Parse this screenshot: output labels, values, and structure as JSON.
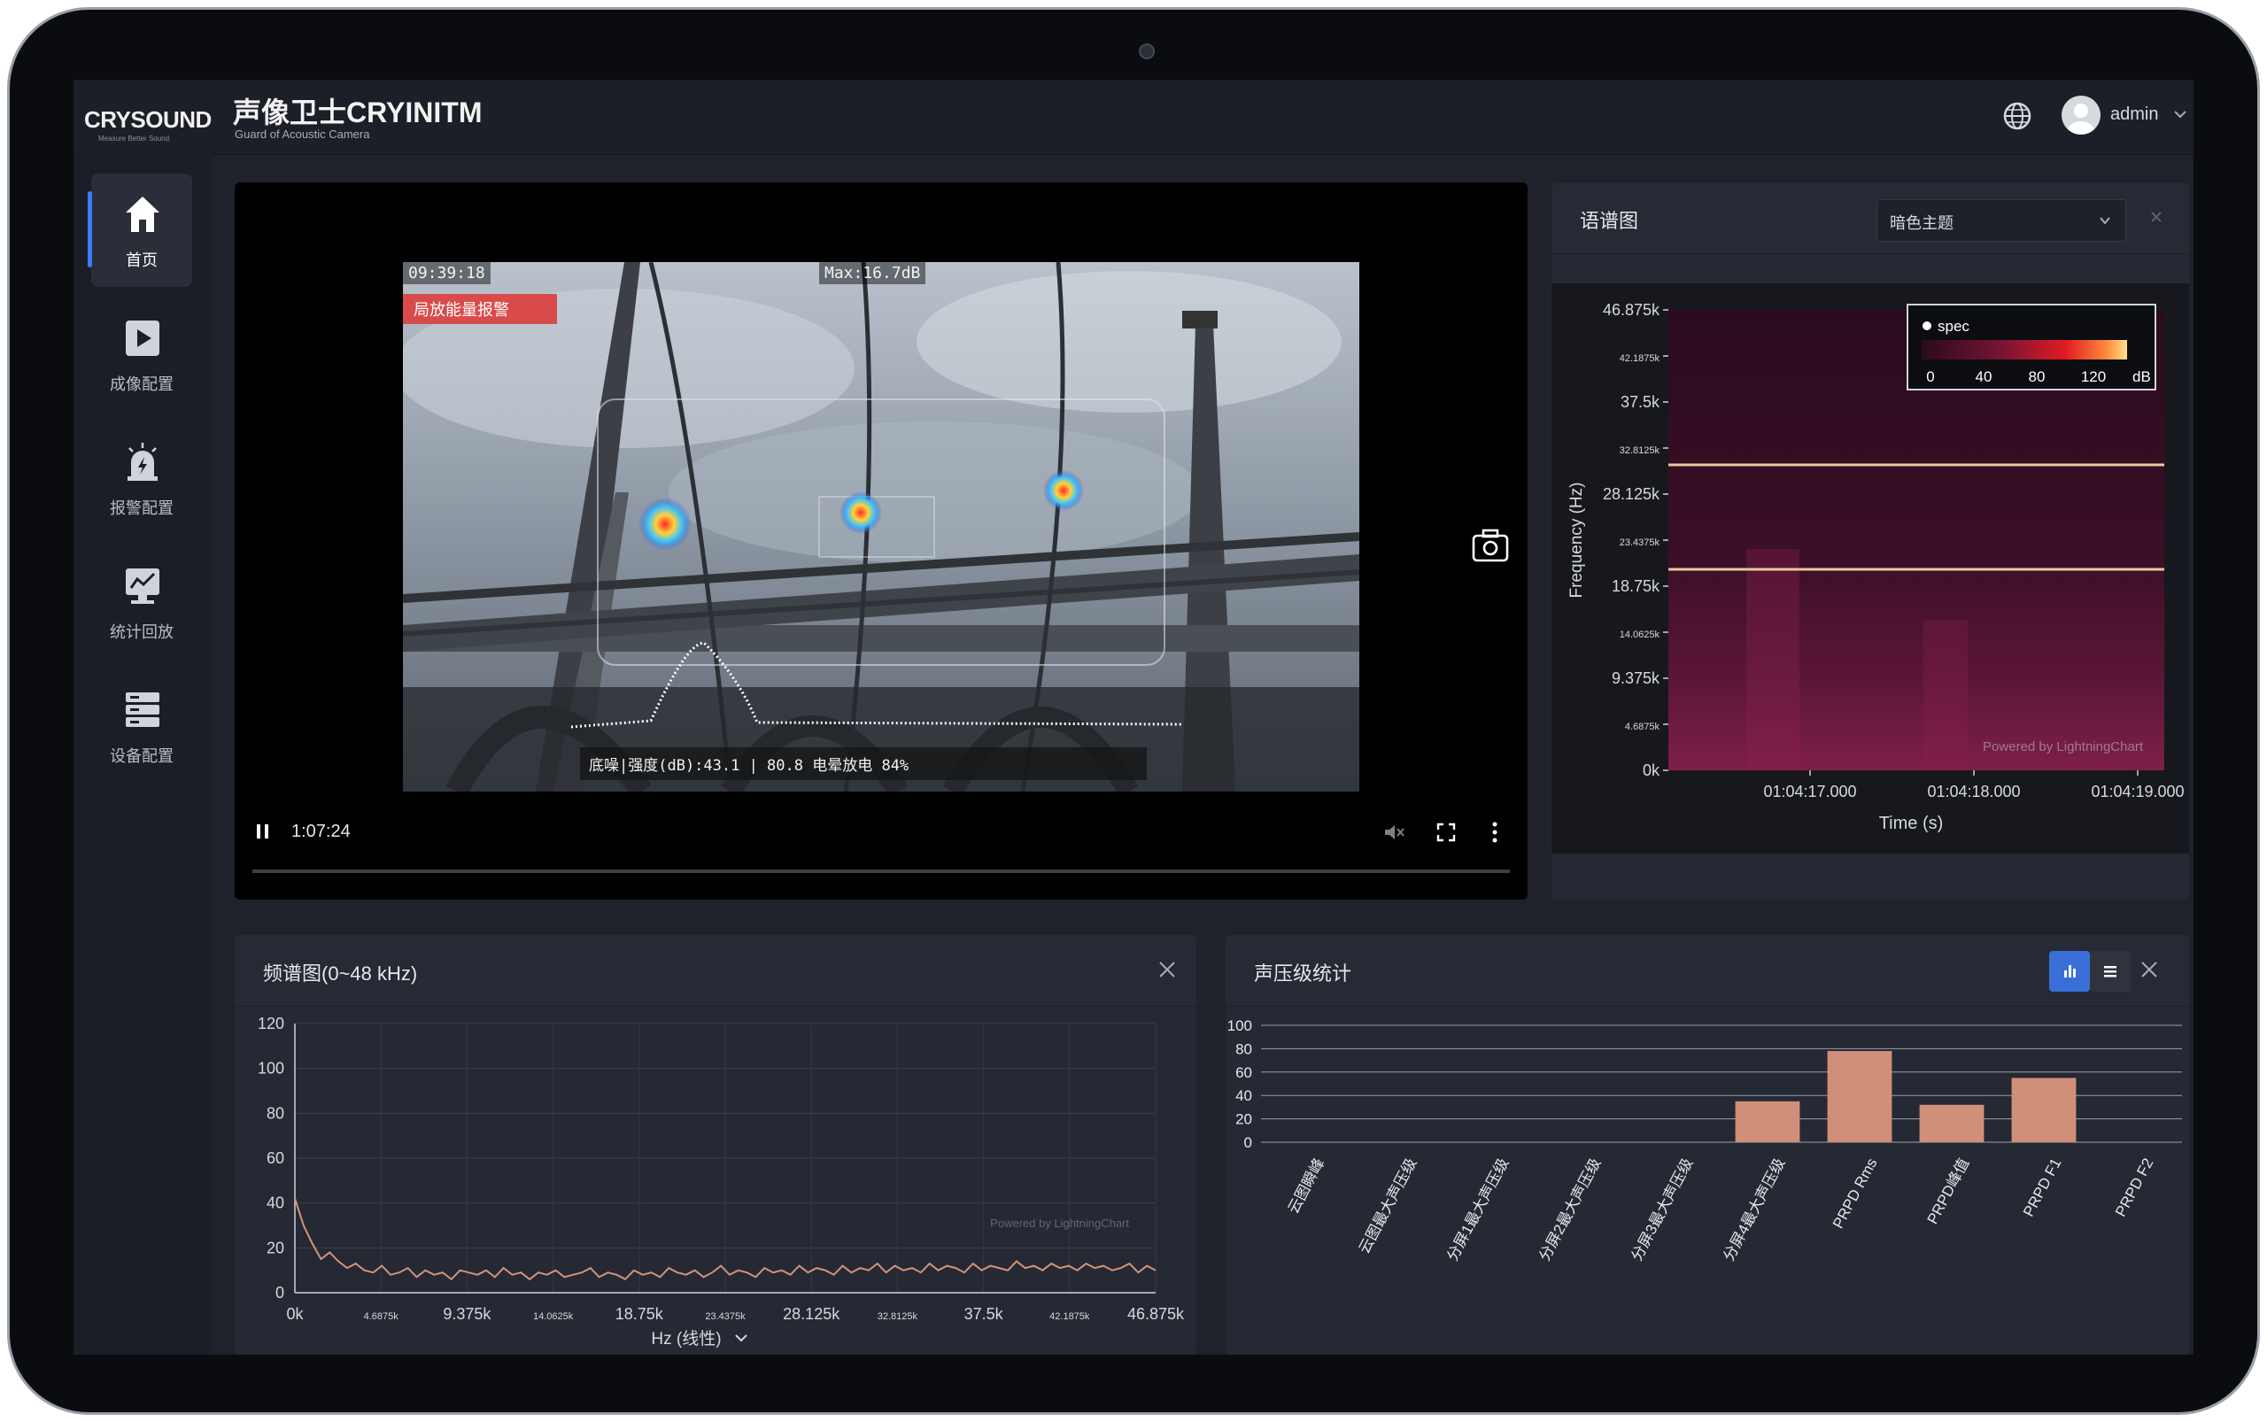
{
  "brand": {
    "name": "CRYSOUND",
    "tagline": "Measure Better Sound"
  },
  "product": {
    "title": "声像卫士CRYINITM",
    "subtitle": "Guard of Acoustic Camera"
  },
  "user": {
    "name": "admin"
  },
  "sidebar": {
    "items": [
      {
        "label": "首页",
        "icon": "home-icon",
        "active": true
      },
      {
        "label": "成像配置",
        "icon": "play-square-icon",
        "active": false
      },
      {
        "label": "报警配置",
        "icon": "alarm-icon",
        "active": false
      },
      {
        "label": "统计回放",
        "icon": "chart-monitor-icon",
        "active": false
      },
      {
        "label": "设备配置",
        "icon": "server-icon",
        "active": false
      }
    ]
  },
  "video": {
    "osd_time": "09:39:18",
    "osd_max": "Max:16.7dB",
    "osd_alarm": "局放能量报警",
    "osd_status": "底噪|强度(dB):43.1 | 80.8      电晕放电 84%",
    "playback_time": "1:07:24"
  },
  "spectrogram_panel": {
    "title": "语谱图",
    "theme_value": "暗色主题",
    "chart_data": {
      "type": "heatmap",
      "ylabel": "Frequency (Hz)",
      "xlabel": "Time (s)",
      "y_ticks_major": [
        "46.875k",
        "37.5k",
        "28.125k",
        "18.75k",
        "9.375k",
        "0k"
      ],
      "y_ticks_minor": [
        "42.1875k",
        "32.8125k",
        "23.4375k",
        "14.0625k",
        "4.6875k"
      ],
      "x_ticks": [
        "01:04:17.000",
        "01:04:18.000",
        "01:04:19.000"
      ],
      "legend": {
        "name": "spec",
        "ticks": [
          "0",
          "40",
          "80",
          "120"
        ],
        "unit": "dB"
      },
      "watermark": "Powered by LightningChart"
    }
  },
  "frequency_panel": {
    "title": "频谱图(0~48 kHz)",
    "chart_data": {
      "type": "line",
      "ylim": [
        0,
        120
      ],
      "y_ticks": [
        0,
        20,
        40,
        60,
        80,
        100,
        120
      ],
      "x_ticks_major": [
        "0k",
        "9.375k",
        "18.75k",
        "28.125k",
        "37.5k",
        "46.875k"
      ],
      "x_ticks_minor": [
        "4.6875k",
        "14.0625k",
        "23.4375k",
        "32.8125k",
        "42.1875k"
      ],
      "xlabel": "Hz (线性)",
      "watermark": "Powered by LightningChart",
      "series_color": "#d2947a",
      "y_values": [
        42,
        30,
        22,
        15,
        18,
        14,
        11,
        13,
        10,
        9,
        12,
        8,
        9,
        11,
        7,
        10,
        8,
        9,
        6,
        10,
        9,
        8,
        10,
        7,
        11,
        8,
        9,
        6,
        9,
        8,
        10,
        7,
        8,
        9,
        11,
        7,
        9,
        8,
        6,
        10,
        8,
        9,
        7,
        11,
        9,
        8,
        10,
        7,
        9,
        12,
        8,
        10,
        9,
        7,
        11,
        9,
        10,
        8,
        12,
        9,
        11,
        10,
        8,
        12,
        9,
        11,
        10,
        13,
        9,
        12,
        10,
        11,
        9,
        13,
        10,
        12,
        11,
        9,
        13,
        10,
        12,
        11,
        10,
        14,
        11,
        12,
        10,
        13,
        11,
        12,
        10,
        13,
        11,
        12,
        10,
        11,
        13,
        9,
        12,
        10
      ]
    }
  },
  "spl_panel": {
    "title": "声压级统计",
    "chart_data": {
      "type": "bar",
      "ylim": [
        0,
        100
      ],
      "y_ticks": [
        0,
        20,
        40,
        60,
        80,
        100
      ],
      "categories": [
        "云图瞬峰",
        "云图最大声压级",
        "分屏1最大声压级",
        "分屏2最大声压级",
        "分屏3最大声压级",
        "分屏4最大声压级",
        "PRPD Rms",
        "PRPD峰值",
        "PRPD F1",
        "PRPD F2"
      ],
      "values": [
        0,
        0,
        0,
        0,
        0,
        35,
        78,
        32,
        55,
        0
      ],
      "bar_color": "#d08f78"
    }
  },
  "colors": {
    "accent": "#3d7cff",
    "panel": "#252933",
    "screen": "#1f222b"
  }
}
